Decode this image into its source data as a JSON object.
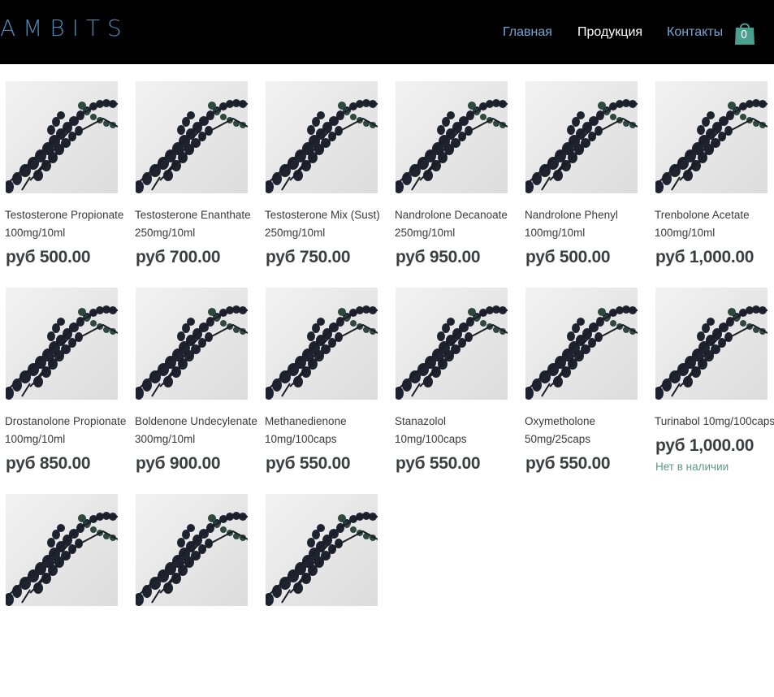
{
  "header": {
    "logo": "AMBITS",
    "nav": [
      "Главная",
      "Продукция",
      "Контакты"
    ],
    "cart_count": "0",
    "colors": {
      "background": "#000000",
      "nav_link": "#74a6d6",
      "nav_active": "#ffffff",
      "cart": "#4aa08f"
    }
  },
  "products": [
    {
      "name": "Testosterone Propionate",
      "dose": "100mg/10ml",
      "price": "руб 500.00"
    },
    {
      "name": "Testosterone Enanthate",
      "dose": "250mg/10ml",
      "price": "руб 700.00"
    },
    {
      "name": "Testosterone Mix (Sust)",
      "dose": "250mg/10ml",
      "price": "руб 750.00"
    },
    {
      "name": "Nandrolone Decanoate",
      "dose": "250mg/10ml",
      "price": "руб 950.00"
    },
    {
      "name": "Nandrolone Phenyl",
      "dose": "100mg/10ml",
      "price": "руб 500.00"
    },
    {
      "name": "Trenbolone Acetate",
      "dose": "100mg/10ml",
      "price": "руб 1,000.00"
    },
    {
      "name": "Drostanolone Propionate",
      "dose": "100mg/10ml",
      "price": "руб 850.00"
    },
    {
      "name": "Boldenone Undecylenate",
      "dose": "300mg/10ml",
      "price": "руб 900.00"
    },
    {
      "name": "Methanedienone",
      "dose": "10mg/100caps",
      "price": "руб 550.00"
    },
    {
      "name": "Stanazolol",
      "dose": "10mg/100caps",
      "price": "руб 550.00"
    },
    {
      "name": "Oxymetholone",
      "dose": "50mg/25caps",
      "price": "руб 550.00"
    },
    {
      "name": "Turinabol 10mg/100caps",
      "dose": "",
      "price": "руб 1,000.00"
    }
  ],
  "stock_status": "Нет в наличии",
  "stock_color": "#5d9a8a",
  "image_icon": "dna-helix-photo"
}
